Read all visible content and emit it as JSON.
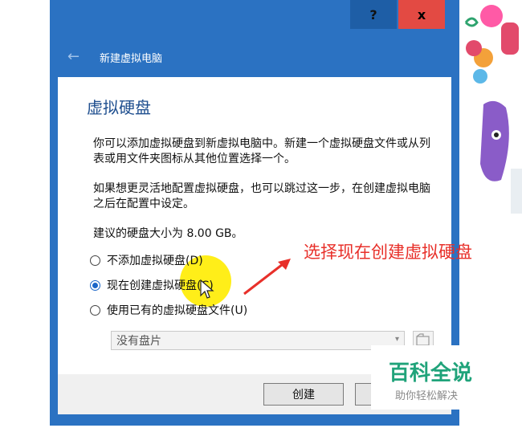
{
  "window": {
    "help_label": "?",
    "close_label": "x",
    "wizard_title": "新建虚拟电脑"
  },
  "page": {
    "heading": "虚拟硬盘",
    "paragraph1": "你可以添加虚拟硬盘到新虚拟电脑中。新建一个虚拟硬盘文件或从列表或用文件夹图标从其他位置选择一个。",
    "paragraph2": "如果想更灵活地配置虚拟硬盘，也可以跳过这一步，在创建虚拟电脑之后在配置中设定。",
    "recommended_size": "建议的硬盘大小为 8.00 GB。"
  },
  "options": [
    {
      "label": "不添加虚拟硬盘(D)",
      "selected": false
    },
    {
      "label": "现在创建虚拟硬盘(C)",
      "selected": true
    },
    {
      "label": "使用已有的虚拟硬盘文件(U)",
      "selected": false
    }
  ],
  "disk_select": {
    "value": "没有盘片"
  },
  "buttons": {
    "create_label": "创建"
  },
  "annotation": {
    "text": "选择现在创建虚拟硬盘",
    "color": "#e8302a"
  },
  "watermark": {
    "title": "百科全说",
    "subtitle": "助你轻松解决"
  },
  "colors": {
    "title_bar": "#2b72c2",
    "close_button": "#e34a43",
    "heading": "#1f4f8f",
    "watermark": "#20a37a"
  },
  "icons": [
    "back-arrow-icon",
    "chevron-down-icon",
    "folder-icon",
    "mouse-cursor-icon"
  ]
}
